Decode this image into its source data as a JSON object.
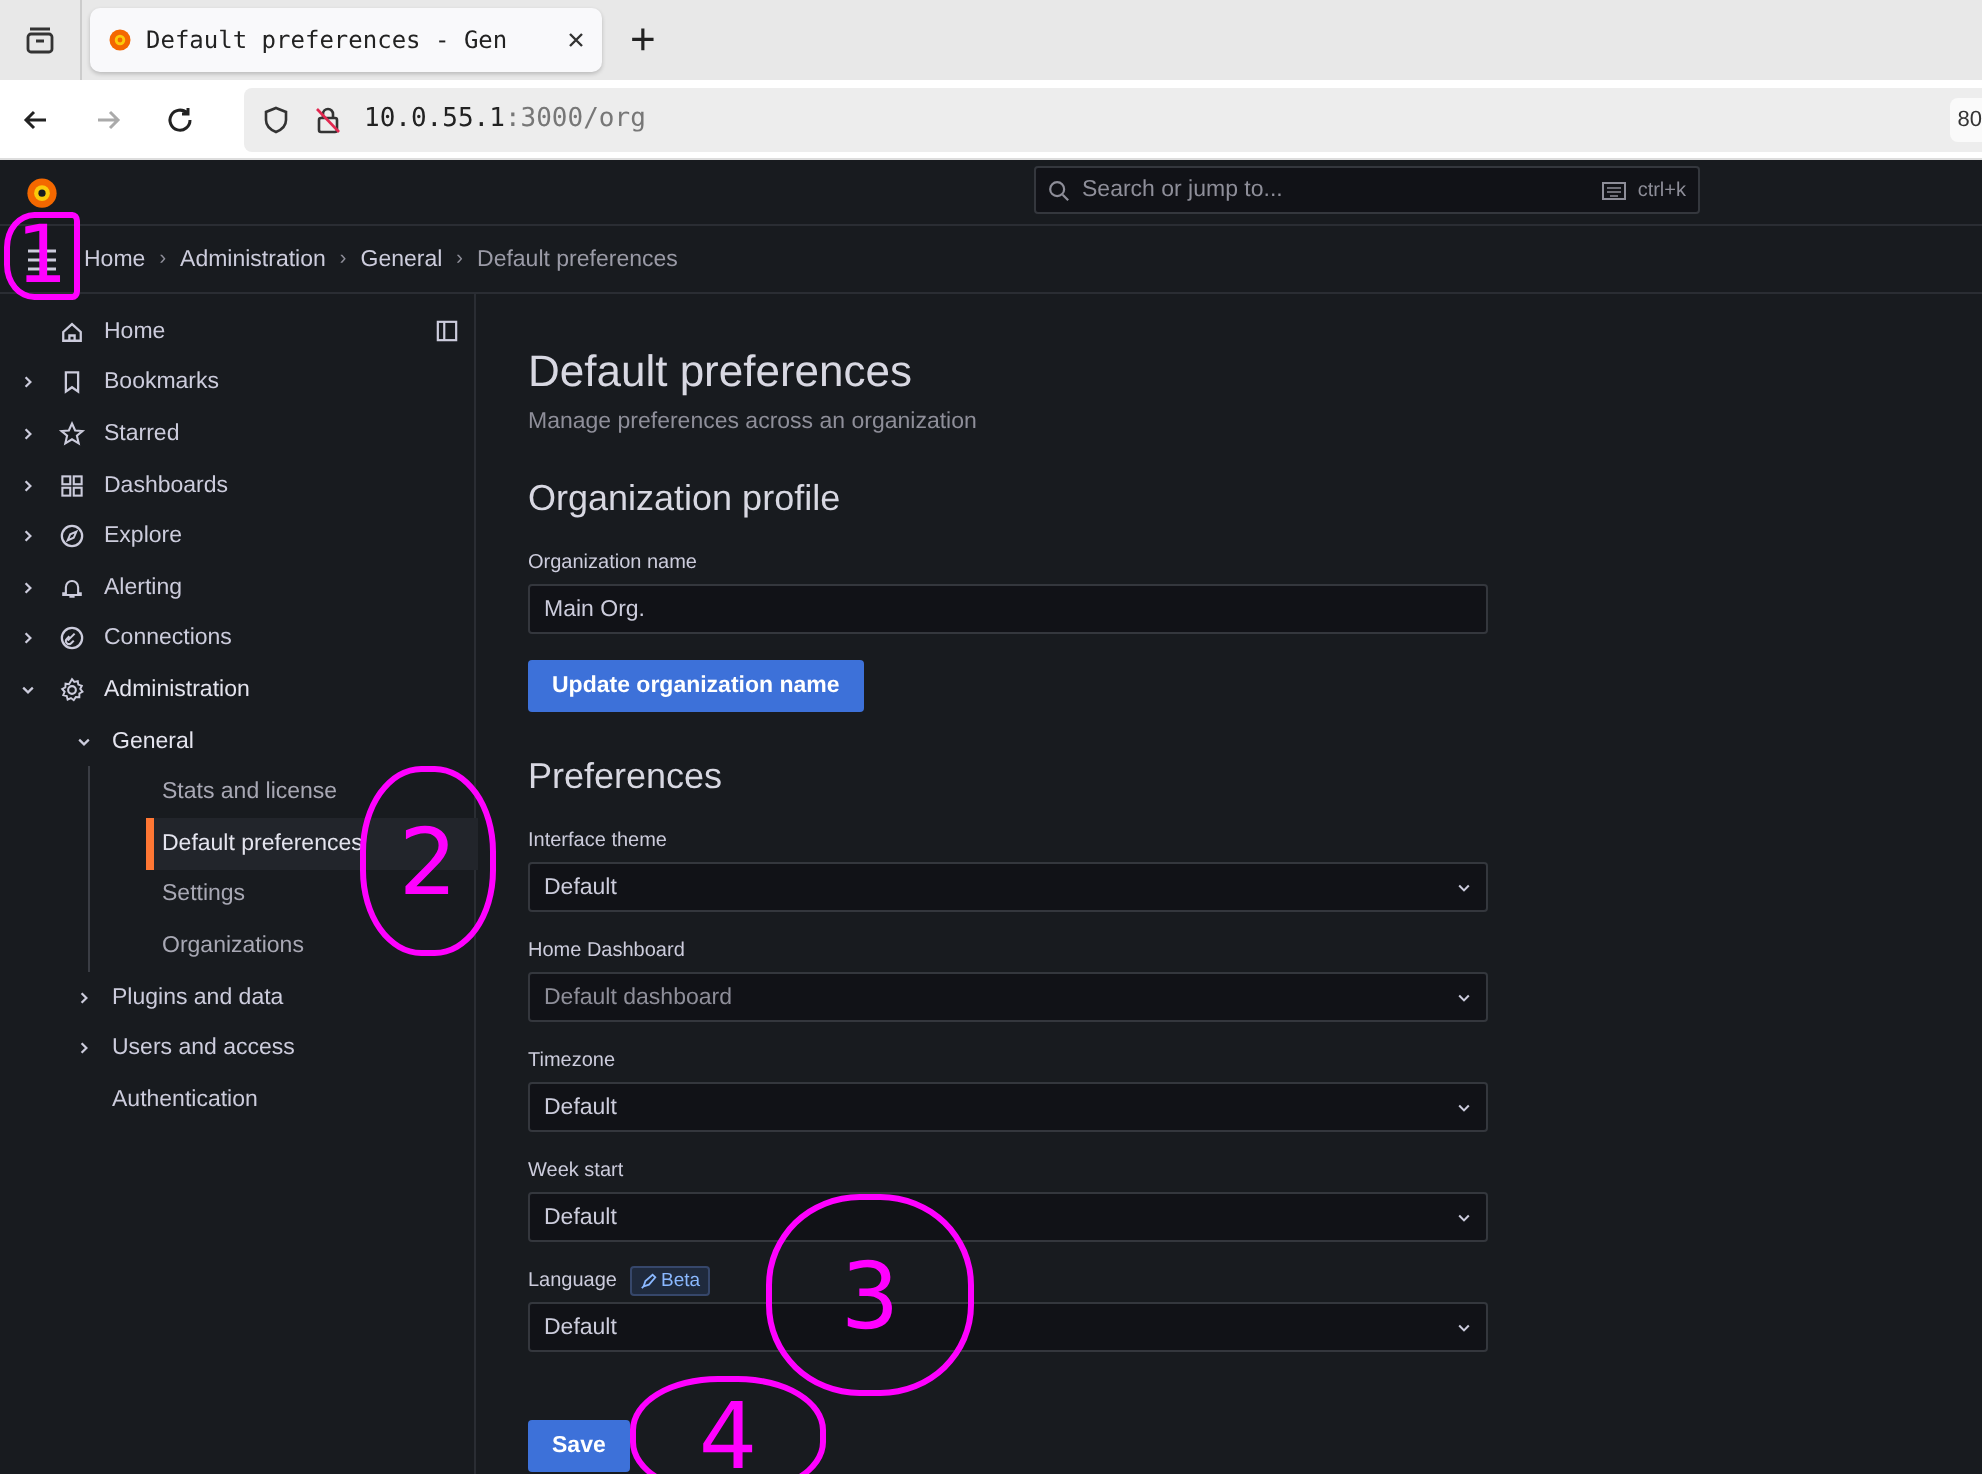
{
  "browser": {
    "tab_title": "Default preferences - Gen",
    "new_tab": "+",
    "url_host": "10.0.55.1",
    "url_rest": ":3000/org",
    "zoom": "80"
  },
  "topbar": {
    "search_placeholder": "Search or jump to...",
    "shortcut": "ctrl+k"
  },
  "breadcrumbs": [
    {
      "label": "Home",
      "separator": "›"
    },
    {
      "label": "Administration",
      "separator": "›"
    },
    {
      "label": "General",
      "separator": "›"
    },
    {
      "label": "Default preferences"
    }
  ],
  "sidebar": {
    "items": [
      {
        "label": "Home",
        "expandable": false,
        "expanded": false
      },
      {
        "label": "Bookmarks",
        "expandable": true,
        "expanded": false
      },
      {
        "label": "Starred",
        "expandable": true,
        "expanded": false
      },
      {
        "label": "Dashboards",
        "expandable": true,
        "expanded": false
      },
      {
        "label": "Explore",
        "expandable": true,
        "expanded": false
      },
      {
        "label": "Alerting",
        "expandable": true,
        "expanded": false
      },
      {
        "label": "Connections",
        "expandable": true,
        "expanded": false
      },
      {
        "label": "Administration",
        "expandable": true,
        "expanded": true,
        "children": [
          {
            "label": "General",
            "expandable": true,
            "expanded": true,
            "children": [
              {
                "label": "Stats and license",
                "selected": false
              },
              {
                "label": "Default preferences",
                "selected": true
              },
              {
                "label": "Settings",
                "selected": false
              },
              {
                "label": "Organizations",
                "selected": false
              }
            ]
          },
          {
            "label": "Plugins and data",
            "expandable": true,
            "expanded": false
          },
          {
            "label": "Users and access",
            "expandable": true,
            "expanded": false
          },
          {
            "label": "Authentication",
            "expandable": false,
            "expanded": false
          }
        ]
      }
    ]
  },
  "page": {
    "title": "Default preferences",
    "subtitle": "Manage preferences across an organization",
    "profile": {
      "heading": "Organization profile",
      "field_label": "Organization name",
      "value": "Main Org.",
      "button": "Update organization name"
    },
    "preferences": {
      "heading": "Preferences",
      "fields": [
        {
          "label": "Interface theme",
          "value": "Default"
        },
        {
          "label": "Home Dashboard",
          "placeholder": "Default dashboard"
        },
        {
          "label": "Timezone",
          "value": "Default"
        },
        {
          "label": "Week start",
          "value": "Default"
        },
        {
          "label": "Language",
          "badge": "Beta",
          "value": "Default"
        }
      ],
      "save": "Save"
    }
  },
  "annotations": [
    {
      "label": "1"
    },
    {
      "label": "2"
    },
    {
      "label": "3"
    },
    {
      "label": "4"
    }
  ]
}
